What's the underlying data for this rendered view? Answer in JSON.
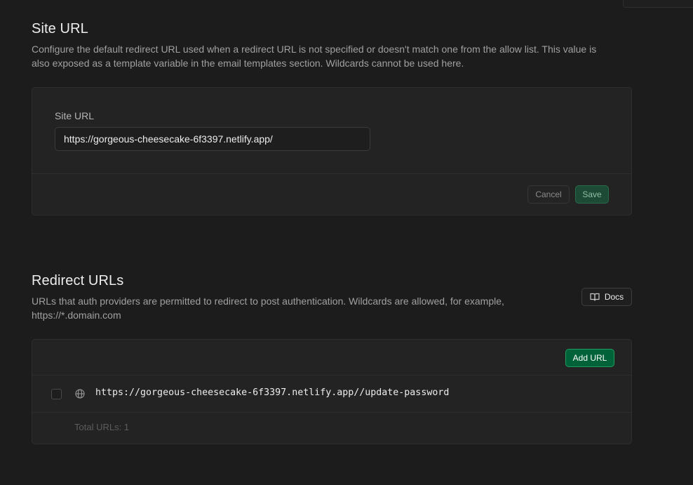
{
  "site_url": {
    "title": "Site URL",
    "description": "Configure the default redirect URL used when a redirect URL is not specified or doesn't match one from the allow list. This value is also exposed as a template variable in the email templates section. Wildcards cannot be used here.",
    "field_label": "Site URL",
    "field_value": "https://gorgeous-cheesecake-6f3397.netlify.app/",
    "cancel_label": "Cancel",
    "save_label": "Save"
  },
  "redirect_urls": {
    "title": "Redirect URLs",
    "description": "URLs that auth providers are permitted to redirect to post authentication. Wildcards are allowed, for example, https://*.domain.com",
    "docs_label": "Docs",
    "add_label": "Add URL",
    "items": [
      {
        "url": "https://gorgeous-cheesecake-6f3397.netlify.app//update-password",
        "icon": "globe-icon"
      }
    ],
    "total_label": "Total URLs: 1"
  },
  "colors": {
    "background": "#1c1c1c",
    "card": "#232323",
    "accent_green": "#006239"
  }
}
